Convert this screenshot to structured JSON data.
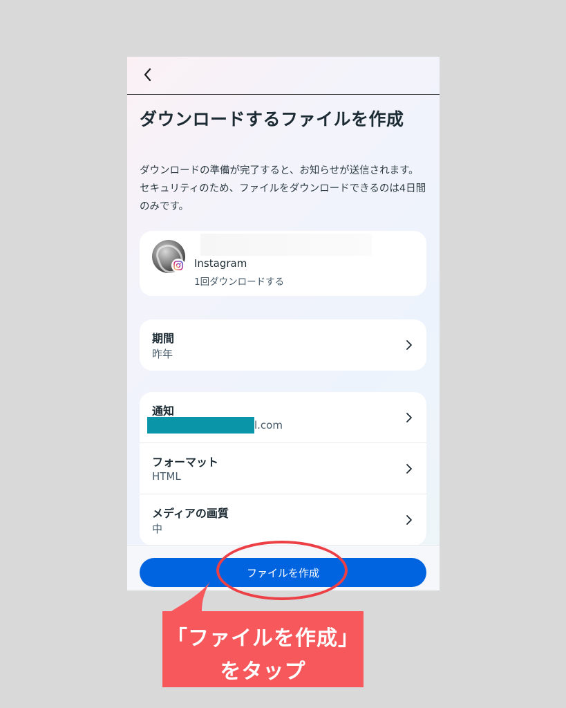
{
  "header": {
    "back_icon": "chevron-left-icon"
  },
  "page": {
    "title": "ダウンロードするファイルを作成",
    "description": "ダウンロードの準備が完了すると、お知らせが送信されます。セキュリティのため、ファイルをダウンロードできるのは4日間のみです。"
  },
  "account": {
    "platform": "Instagram",
    "download_label": "1回ダウンロードする",
    "badge_icon": "instagram-icon"
  },
  "period": {
    "label": "期間",
    "value": "昨年"
  },
  "settings": {
    "notification": {
      "label": "通知",
      "value_suffix": "l.com"
    },
    "format": {
      "label": "フォーマット",
      "value": "HTML"
    },
    "media_quality": {
      "label": "メディアの画質",
      "value": "中"
    }
  },
  "footer": {
    "create_button_label": "ファイルを作成"
  },
  "annotation": {
    "line1": "「ファイルを作成」",
    "line2": "をタップ"
  },
  "colors": {
    "primary_button": "#0064e0",
    "annotation_red": "#ec3f46",
    "annotation_box": "#f6585c",
    "redaction": "#0a96a8"
  }
}
